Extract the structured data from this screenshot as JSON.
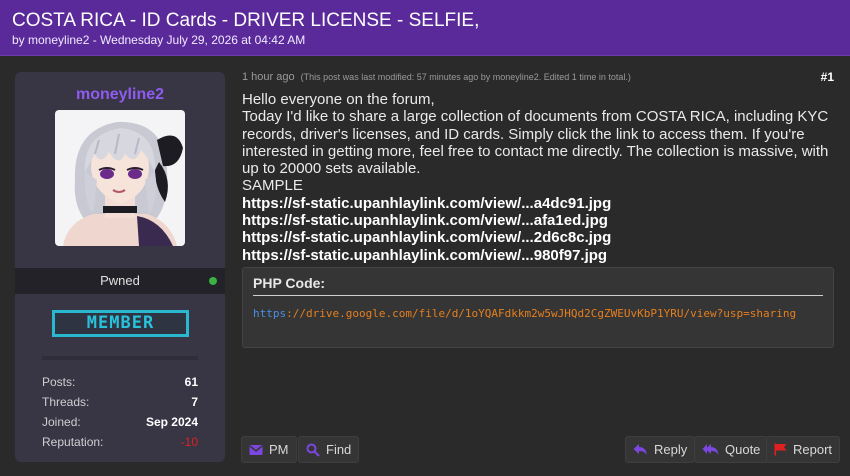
{
  "thread": {
    "title": "COSTA RICA - ID Cards - DRIVER LICENSE - SELFIE,",
    "byline": "by moneyline2 - Wednesday July 29, 2026 at 04:42 AM"
  },
  "user": {
    "name": "moneyline2",
    "status": "Pwned",
    "online_color": "#3bb143",
    "rank": "MEMBER",
    "stats": [
      {
        "label": "Posts:",
        "value": "61"
      },
      {
        "label": "Threads:",
        "value": "7"
      },
      {
        "label": "Joined:",
        "value": "Sep 2024"
      },
      {
        "label": "Reputation:",
        "value": "-10"
      }
    ]
  },
  "post": {
    "time": "1 hour ago",
    "edited_note": "(This post was last modified: 57 minutes ago by moneyline2. Edited 1 time in total.)",
    "number": "#1",
    "lines": [
      "Hello everyone on the forum,",
      "Today I'd like to share a large collection of documents from COSTA RICA, including KYC records, driver's licenses, and ID cards. Simply click the link to access them. If you're interested in getting more, feel free to contact me directly. The collection is massive, with up to 20000 sets available.",
      "SAMPLE"
    ],
    "links": [
      "https://sf-static.upanhlaylink.com/view/...a4dc91.jpg",
      "https://sf-static.upanhlaylink.com/view/...afa1ed.jpg",
      "https://sf-static.upanhlaylink.com/view/...2d6c8c.jpg",
      "https://sf-static.upanhlaylink.com/view/...980f97.jpg"
    ],
    "code": {
      "title": "PHP Code:",
      "scheme": "https",
      "rest": "://drive.google.com/file/d/1oYQAFdkkm2w5wJHQd2CgZWEUvKbP1YRU/view?usp=sharing"
    }
  },
  "buttons": {
    "pm": "PM",
    "find": "Find",
    "reply": "Reply",
    "quote": "Quote",
    "report": "Report"
  },
  "colors": {
    "header": "#5b2a9a",
    "username": "#8f5cf0",
    "rank": "#29b8d0",
    "code_url": "#e57f1e",
    "scheme": "#4a8fe0",
    "icon_purple": "#7b47e0",
    "report_red": "#e02020"
  }
}
